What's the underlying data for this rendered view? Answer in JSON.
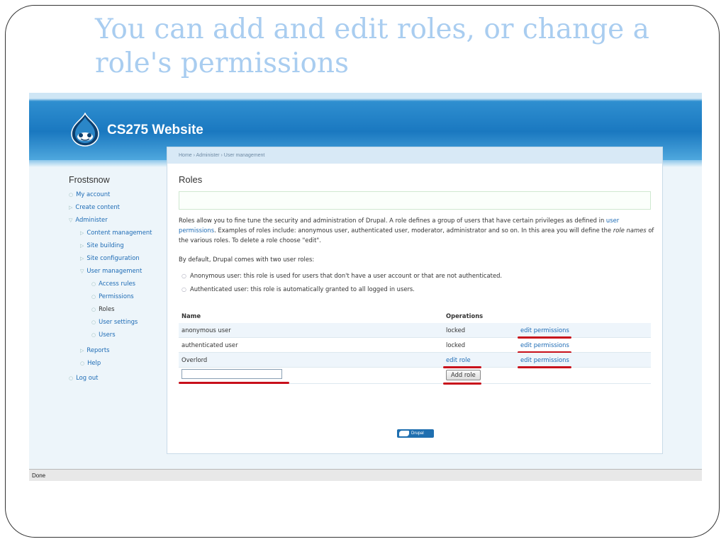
{
  "slide": {
    "title": "You can add and edit roles, or change a role's permissions"
  },
  "site": {
    "name": "CS275 Website",
    "footer_badge": "Drupal"
  },
  "breadcrumb": "Home › Administer › User management",
  "sidebar": {
    "user_name": "Frostsnow",
    "items": [
      {
        "label": "My account",
        "level": 0
      },
      {
        "label": "Create content",
        "level": 0
      },
      {
        "label": "Administer",
        "level": 0
      },
      {
        "label": "Content management",
        "level": 1
      },
      {
        "label": "Site building",
        "level": 1
      },
      {
        "label": "Site configuration",
        "level": 1
      },
      {
        "label": "User management",
        "level": 1
      },
      {
        "label": "Access rules",
        "level": 2
      },
      {
        "label": "Permissions",
        "level": 2
      },
      {
        "label": "Roles",
        "level": 2
      },
      {
        "label": "User settings",
        "level": 2
      },
      {
        "label": "Users",
        "level": 2
      },
      {
        "label": "Reports",
        "level": 1
      },
      {
        "label": "Help",
        "level": 1
      },
      {
        "label": "Log out",
        "level": 0
      }
    ]
  },
  "main": {
    "title": "Roles",
    "intro_part1": "Roles allow you to fine tune the security and administration of Drupal. A role defines a group of users that have certain privileges as defined in",
    "intro_link": "user permissions",
    "intro_part2": ". Examples of roles include: anonymous user, authenticated user, moderator, administrator and so on. In this area you will define the",
    "intro_em": "role names",
    "intro_part3": "of the various roles. To delete a role choose \"edit\".",
    "default_text": "By default, Drupal comes with two user roles:",
    "bullets": [
      "Anonymous user: this role is used for users that don't have a user account or that are not authenticated.",
      "Authenticated user: this role is automatically granted to all logged in users."
    ],
    "table": {
      "headers": {
        "name": "Name",
        "operations": "Operations"
      },
      "rows": [
        {
          "name": "anonymous user",
          "op1": "locked",
          "op2": "edit permissions"
        },
        {
          "name": "authenticated user",
          "op1": "locked",
          "op2": "edit permissions"
        },
        {
          "name": "Overlord",
          "op1": "edit role",
          "op2": "edit permissions"
        }
      ],
      "new_role_value": "",
      "add_button": "Add role"
    }
  },
  "statusbar": {
    "text": "Done"
  },
  "colors": {
    "annotation_underline": "#c8101b",
    "link": "#1d6bb5",
    "title": "#a9cdf0"
  }
}
